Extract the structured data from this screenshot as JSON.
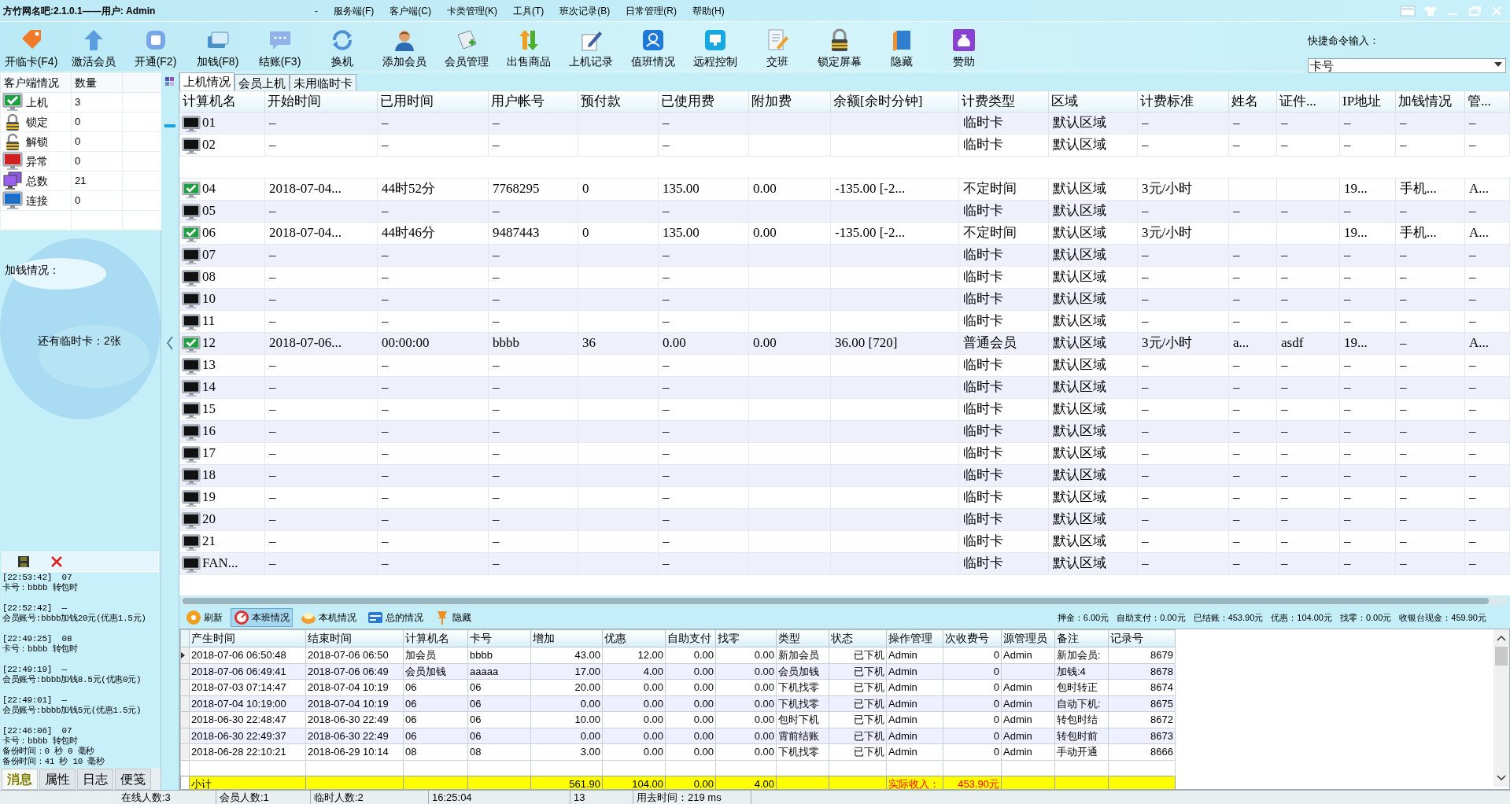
{
  "title_bar": {
    "title": "方竹网名吧:2.1.0.1——用户: Admin",
    "menu": [
      "-",
      "服务端(F)",
      "客户端(C)",
      "卡类管理(K)",
      "工具(T)",
      "班次记录(B)",
      "日常管理(R)",
      "帮助(H)"
    ]
  },
  "toolbar": {
    "buttons": [
      "开临卡(F4)",
      "激活会员",
      "开通(F2)",
      "加钱(F8)",
      "结账(F3)",
      "换机",
      "添加会员",
      "会员管理",
      "出售商品",
      "上机记录",
      "值班情况",
      "远程控制",
      "交班",
      "锁定屏幕",
      "隐藏",
      "赞助"
    ],
    "quick_command": {
      "label": "快捷命令输入：",
      "value": "卡号"
    }
  },
  "client_status": {
    "columns": [
      "客户端情况",
      "数量"
    ],
    "rows": [
      {
        "label": "上机",
        "count": "3"
      },
      {
        "label": "锁定",
        "count": "0"
      },
      {
        "label": "解锁",
        "count": "0"
      },
      {
        "label": "异常",
        "count": "0"
      },
      {
        "label": "总数",
        "count": "21"
      },
      {
        "label": "连接",
        "count": "0"
      }
    ]
  },
  "money_panel": {
    "title": "加钱情况：",
    "note": "还有临时卡：2张"
  },
  "messages": [
    {
      "header": "[22:53:42]  07",
      "lines": [
        "卡号：bbbb 转包时"
      ]
    },
    {
      "header": "[22:52:42]  —",
      "lines": [
        "会员账号:bbbb加钱20元(优惠1.5元)"
      ]
    },
    {
      "header": "[22:49:25]  08",
      "lines": [
        "卡号：bbbb 转包时"
      ]
    },
    {
      "header": "[22:49:19]  —",
      "lines": [
        "会员账号:bbbb加钱8.5元(优惠0元)"
      ]
    },
    {
      "header": "[22:49:01]  —",
      "lines": [
        "会员账号:bbbb加钱5元(优惠1.5元)"
      ]
    },
    {
      "header": "[22:46:06]  07",
      "lines": [
        "卡号：bbbb 转包时",
        "备份时间：0 秒 0 毫秒",
        "备份时间：41 秒 10 毫秒"
      ]
    }
  ],
  "left_tabs": [
    {
      "label": "消息",
      "selected": true
    },
    {
      "label": "属性",
      "selected": false
    },
    {
      "label": "日志",
      "selected": false
    },
    {
      "label": "便笺",
      "selected": false
    }
  ],
  "main_tabs": [
    {
      "label": "上机情况",
      "selected": true
    },
    {
      "label": "会员上机",
      "selected": false
    },
    {
      "label": "未用临时卡",
      "selected": false
    }
  ],
  "main_table": {
    "columns": [
      "计算机名",
      "开始时间",
      "已用时间",
      "用户帐号",
      "预付款",
      "已使用费",
      "附加费",
      "余额[余时分钟]",
      "计费类型",
      "区域",
      "计费标准",
      "姓名",
      "证件...",
      "IP地址",
      "加钱情况",
      "管..."
    ],
    "rows": [
      {
        "kind": "machine",
        "name": "01",
        "online": false,
        "cells": [
          "–",
          "–",
          "–",
          "",
          "–",
          "",
          "",
          "临时卡",
          "默认区域",
          "–",
          "–",
          "–",
          "–",
          "–",
          "–"
        ]
      },
      {
        "kind": "machine",
        "name": "02",
        "online": false,
        "cells": [
          "–",
          "–",
          "–",
          "",
          "–",
          "",
          "",
          "临时卡",
          "默认区域",
          "–",
          "–",
          "–",
          "–",
          "–",
          "–"
        ]
      },
      {
        "kind": "blank"
      },
      {
        "kind": "machine",
        "name": "04",
        "online": true,
        "cells": [
          "2018-07-04...",
          "44时52分",
          "7768295",
          "0",
          "135.00",
          "0.00",
          "-135.00 [-2...",
          "不定时间",
          "默认区域",
          "3元/小时",
          "",
          "",
          "19...",
          "手机...",
          "A..."
        ]
      },
      {
        "kind": "machine",
        "name": "05",
        "online": false,
        "cells": [
          "–",
          "–",
          "–",
          "",
          "–",
          "",
          "",
          "临时卡",
          "默认区域",
          "–",
          "–",
          "–",
          "–",
          "–",
          "–"
        ]
      },
      {
        "kind": "machine",
        "name": "06",
        "online": true,
        "cells": [
          "2018-07-04...",
          "44时46分",
          "9487443",
          "0",
          "135.00",
          "0.00",
          "-135.00 [-2...",
          "不定时间",
          "默认区域",
          "3元/小时",
          "",
          "",
          "19...",
          "手机...",
          "A..."
        ]
      },
      {
        "kind": "machine",
        "name": "07",
        "online": false,
        "cells": [
          "–",
          "–",
          "–",
          "",
          "–",
          "",
          "",
          "临时卡",
          "默认区域",
          "–",
          "–",
          "–",
          "–",
          "–",
          "–"
        ]
      },
      {
        "kind": "machine",
        "name": "08",
        "online": false,
        "cells": [
          "–",
          "–",
          "–",
          "",
          "–",
          "",
          "",
          "临时卡",
          "默认区域",
          "–",
          "–",
          "–",
          "–",
          "–",
          "–"
        ]
      },
      {
        "kind": "machine",
        "name": "10",
        "online": false,
        "cells": [
          "–",
          "–",
          "–",
          "",
          "–",
          "",
          "",
          "临时卡",
          "默认区域",
          "–",
          "–",
          "–",
          "–",
          "–",
          "–"
        ]
      },
      {
        "kind": "machine",
        "name": "11",
        "online": false,
        "cells": [
          "–",
          "–",
          "–",
          "",
          "–",
          "",
          "",
          "临时卡",
          "默认区域",
          "–",
          "–",
          "–",
          "–",
          "–",
          "–"
        ]
      },
      {
        "kind": "machine",
        "name": "12",
        "online": true,
        "cells": [
          "2018-07-06...",
          "00:00:00",
          "bbbb",
          "36",
          "0.00",
          "0.00",
          "36.00 [720]",
          "普通会员",
          "默认区域",
          "3元/小时",
          "a...",
          "asdf",
          "19...",
          "–",
          "A..."
        ]
      },
      {
        "kind": "machine",
        "name": "13",
        "online": false,
        "cells": [
          "–",
          "–",
          "–",
          "",
          "–",
          "",
          "",
          "临时卡",
          "默认区域",
          "–",
          "–",
          "–",
          "–",
          "–",
          "–"
        ]
      },
      {
        "kind": "machine",
        "name": "14",
        "online": false,
        "cells": [
          "–",
          "–",
          "–",
          "",
          "–",
          "",
          "",
          "临时卡",
          "默认区域",
          "–",
          "–",
          "–",
          "–",
          "–",
          "–"
        ]
      },
      {
        "kind": "machine",
        "name": "15",
        "online": false,
        "cells": [
          "–",
          "–",
          "–",
          "",
          "–",
          "",
          "",
          "临时卡",
          "默认区域",
          "–",
          "–",
          "–",
          "–",
          "–",
          "–"
        ]
      },
      {
        "kind": "machine",
        "name": "16",
        "online": false,
        "cells": [
          "–",
          "–",
          "–",
          "",
          "–",
          "",
          "",
          "临时卡",
          "默认区域",
          "–",
          "–",
          "–",
          "–",
          "–",
          "–"
        ]
      },
      {
        "kind": "machine",
        "name": "17",
        "online": false,
        "cells": [
          "–",
          "–",
          "–",
          "",
          "–",
          "",
          "",
          "临时卡",
          "默认区域",
          "–",
          "–",
          "–",
          "–",
          "–",
          "–"
        ]
      },
      {
        "kind": "machine",
        "name": "18",
        "online": false,
        "cells": [
          "–",
          "–",
          "–",
          "",
          "–",
          "",
          "",
          "临时卡",
          "默认区域",
          "–",
          "–",
          "–",
          "–",
          "–",
          "–"
        ]
      },
      {
        "kind": "machine",
        "name": "19",
        "online": false,
        "cells": [
          "–",
          "–",
          "–",
          "",
          "–",
          "",
          "",
          "临时卡",
          "默认区域",
          "–",
          "–",
          "–",
          "–",
          "–",
          "–"
        ]
      },
      {
        "kind": "machine",
        "name": "20",
        "online": false,
        "cells": [
          "–",
          "–",
          "–",
          "",
          "–",
          "",
          "",
          "临时卡",
          "默认区域",
          "–",
          "–",
          "–",
          "–",
          "–",
          "–"
        ]
      },
      {
        "kind": "machine",
        "name": "21",
        "online": false,
        "cells": [
          "–",
          "–",
          "–",
          "",
          "–",
          "",
          "",
          "临时卡",
          "默认区域",
          "–",
          "–",
          "–",
          "–",
          "–",
          "–"
        ]
      },
      {
        "kind": "machine",
        "name": "FAN...",
        "online": false,
        "cells": [
          "–",
          "–",
          "–",
          "",
          "–",
          "",
          "",
          "临时卡",
          "默认区域",
          "–",
          "–",
          "–",
          "–",
          "–",
          "–"
        ]
      }
    ]
  },
  "bottom_toolbar": {
    "buttons": [
      {
        "label": "刷新",
        "selected": false
      },
      {
        "label": "本班情况",
        "selected": true
      },
      {
        "label": "本机情况",
        "selected": false
      },
      {
        "label": "总的情况",
        "selected": false
      },
      {
        "label": "隐藏",
        "selected": false
      }
    ],
    "summary": [
      "押金：6.00元",
      "自助支付：0.00元",
      "已结账：453.90元",
      "优惠：104.00元",
      "找零：0.00元",
      "收银台现金：459.90元"
    ]
  },
  "records_table": {
    "columns": [
      "产生时间",
      "结束时间",
      "计算机名",
      "卡号",
      "增加",
      "优惠",
      "自助支付",
      "找零",
      "类型",
      "状态",
      "操作管理",
      "次收费号",
      "源管理员",
      "备注",
      "记录号"
    ],
    "rows": [
      {
        "current": true,
        "cells": [
          "2018-07-06 06:50:48",
          "2018-07-06 06:50",
          "加会员",
          "bbbb",
          "43.00",
          "12.00",
          "0.00",
          "0.00",
          "新加会员",
          "已下机",
          "Admin",
          "0",
          "Admin",
          "新加会员:",
          "8679"
        ]
      },
      {
        "current": false,
        "cells": [
          "2018-07-06 06:49:41",
          "2018-07-06 06:49",
          "会员加钱",
          "aaaaa",
          "17.00",
          "4.00",
          "0.00",
          "0.00",
          "会员加钱",
          "已下机",
          "Admin",
          "0",
          "",
          "加钱:4",
          "8678"
        ]
      },
      {
        "current": false,
        "cells": [
          "2018-07-03 07:14:47",
          "2018-07-04 10:19",
          "06",
          "06",
          "20.00",
          "0.00",
          "0.00",
          "0.00",
          "下机找零",
          "已下机",
          "Admin",
          "0",
          "Admin",
          "包时转正",
          "8674"
        ]
      },
      {
        "current": false,
        "cells": [
          "2018-07-04 10:19:00",
          "2018-07-04 10:19",
          "06",
          "06",
          "0.00",
          "0.00",
          "0.00",
          "0.00",
          "下机找零",
          "已下机",
          "Admin",
          "0",
          "Admin",
          "自动下机:",
          "8675"
        ]
      },
      {
        "current": false,
        "cells": [
          "2018-06-30 22:48:47",
          "2018-06-30 22:49",
          "06",
          "06",
          "10.00",
          "0.00",
          "0.00",
          "0.00",
          "包时下机",
          "已下机",
          "Admin",
          "0",
          "Admin",
          "转包时结",
          "8672"
        ]
      },
      {
        "current": false,
        "cells": [
          "2018-06-30 22:49:37",
          "2018-06-30 22:49",
          "06",
          "06",
          "0.00",
          "0.00",
          "0.00",
          "0.00",
          "霄前结账",
          "已下机",
          "Admin",
          "0",
          "Admin",
          "转包时前",
          "8673"
        ]
      },
      {
        "current": false,
        "cells": [
          "2018-06-28 22:10:21",
          "2018-06-29 10:14",
          "08",
          "08",
          "3.00",
          "0.00",
          "0.00",
          "0.00",
          "下机找零",
          "已下机",
          "Admin",
          "0",
          "Admin",
          "手动开通",
          "8666"
        ]
      }
    ],
    "subtotal": {
      "label": "小计",
      "values": [
        "561.90",
        "104.00",
        "0.00",
        "4.00"
      ],
      "income_label": "实际收入：",
      "income": "453.90元"
    }
  },
  "status_bar": [
    "在线人数:3",
    "会员人数:1",
    "临时人数:2",
    "16:25:04",
    "13",
    "用去时间：219 ms"
  ]
}
